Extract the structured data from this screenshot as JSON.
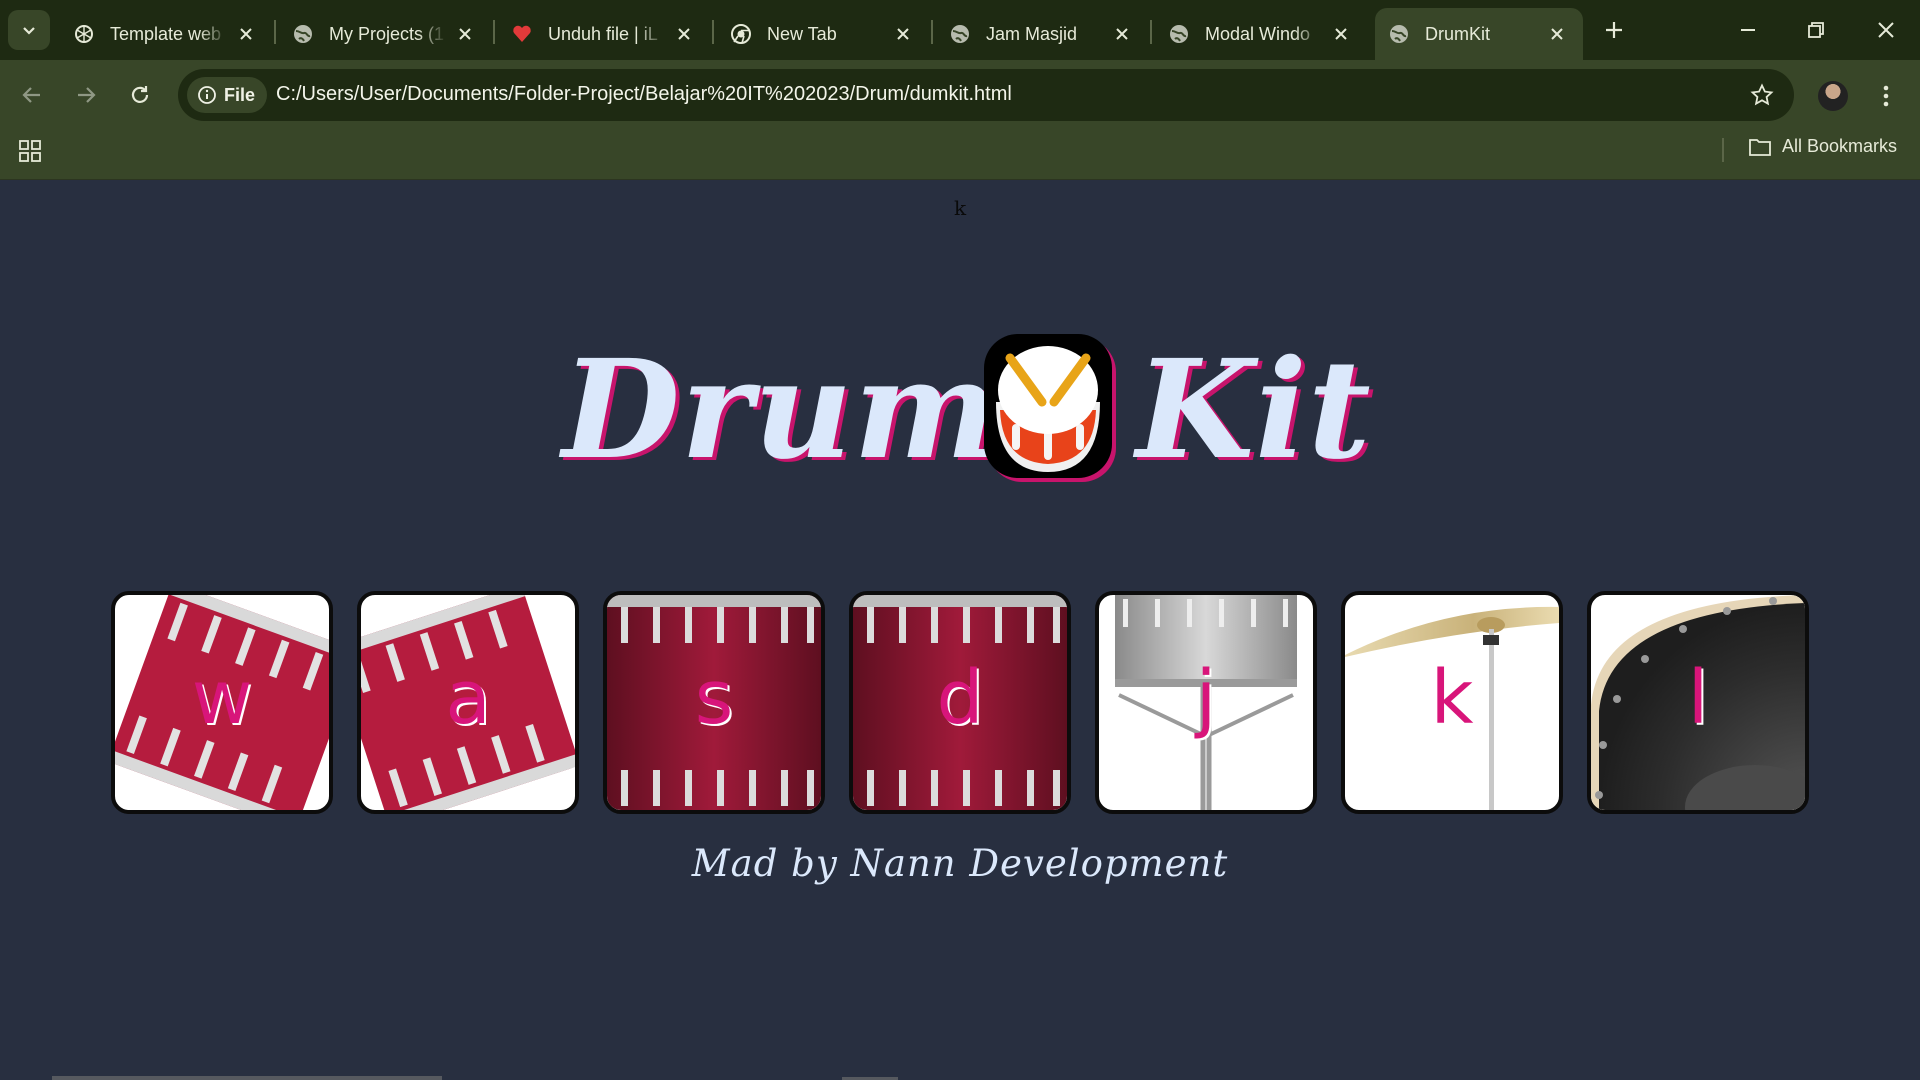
{
  "browser": {
    "tabs": [
      {
        "label": "Template web",
        "icon": "openai-icon",
        "active": false
      },
      {
        "label": "My Projects (1",
        "icon": "globe-icon",
        "active": false
      },
      {
        "label": "Unduh file | iL",
        "icon": "heart-icon",
        "active": false
      },
      {
        "label": "New Tab",
        "icon": "chrome-icon",
        "active": false
      },
      {
        "label": "Jam Masjid",
        "icon": "globe-icon",
        "active": false
      },
      {
        "label": "Modal Windo",
        "icon": "globe-icon",
        "active": false
      },
      {
        "label": "DrumKit",
        "icon": "globe-icon",
        "active": true
      }
    ],
    "chip_label": "File",
    "url": "C:/Users/User/Documents/Folder-Project/Belajar%20IT%202023/Drum/dumkit.html",
    "all_bookmarks_label": "All Bookmarks",
    "colors": {
      "frame": "#1e2a12",
      "toolbar": "#384628",
      "text": "#e6ead8"
    }
  },
  "page": {
    "pressed_key": "k",
    "title_left": "Drum",
    "title_right": "Kit",
    "title_emoji": "drum-emoji",
    "keys": [
      {
        "letter": "w",
        "drum": "tom-tilted"
      },
      {
        "letter": "a",
        "drum": "tom-tilted"
      },
      {
        "letter": "s",
        "drum": "snare-red"
      },
      {
        "letter": "d",
        "drum": "snare-red"
      },
      {
        "letter": "j",
        "drum": "snare-silver"
      },
      {
        "letter": "k",
        "drum": "crash-cymbal"
      },
      {
        "letter": "l",
        "drum": "kick-drum"
      }
    ],
    "credit": "Mad by Nann Development",
    "colors": {
      "background": "#282f40",
      "title": "#dbe8fb",
      "accent": "#d8157a"
    }
  }
}
